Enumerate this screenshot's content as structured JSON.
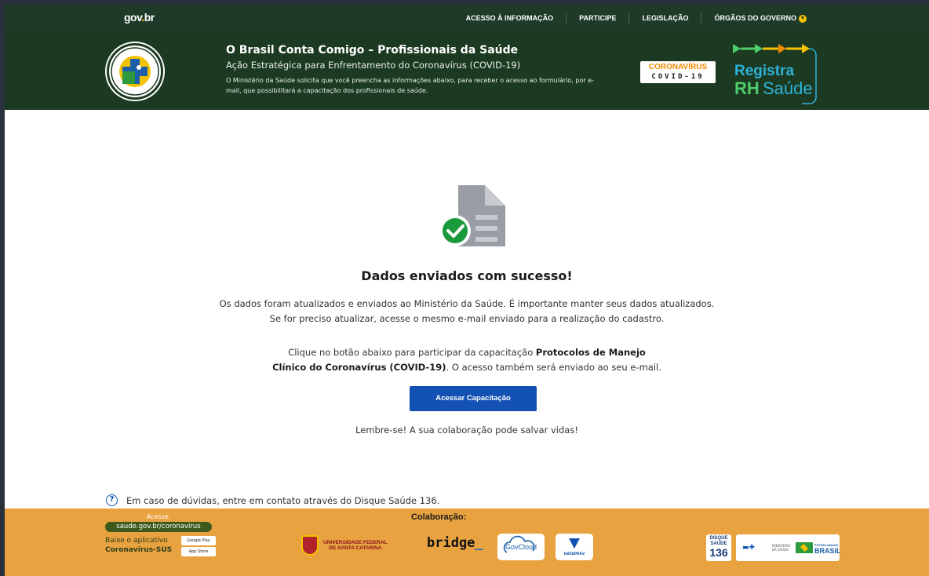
{
  "govbar": {
    "logo_main": "gov",
    "logo_dot": ".",
    "logo_suffix": "br",
    "links": [
      {
        "label": "ACESSO À INFORMAÇÃO"
      },
      {
        "label": "PARTICIPE"
      },
      {
        "label": "LEGISLAÇÃO"
      },
      {
        "label": "ÓRGÃOS DO GOVERNO"
      }
    ]
  },
  "header": {
    "title": "O Brasil Conta Comigo – Profissionais da Saúde",
    "subtitle": "Ação Estratégica para Enfrentamento do Coronavírus (COVID-19)",
    "description": "O Ministério da Saúde solicita que você preencha as informações abaixo, para receber o acesso ao formulário, por e-mail, que possibilitará a capacitação dos profissionais de saúde.",
    "seal_text_top": "CONTRA O CORONAVÍRUS",
    "seal_text_bottom": "O BRASIL CONTA COMIGO",
    "covid_badge_line1": "CORONAVÍRUS",
    "covid_badge_line2": "COVID-19",
    "rh_registra": "Registra",
    "rh_rh": "RH",
    "rh_saude": "Saúde"
  },
  "main": {
    "title": "Dados enviados com sucesso!",
    "line1": "Os dados foram atualizados e enviados ao Ministério da Saúde. É importante manter seus dados atualizados.",
    "line2": "Se for preciso atualizar, acesse o mesmo e-mail enviado para a realização do cadastro.",
    "cta_pre": "Clique no botão abaixo para participar da capacitação ",
    "cta_bold": "Protocolos de Manejo Clínico do Coronavírus (COVID-19)",
    "cta_post": ". O acesso também será enviado ao seu e-mail.",
    "button_label": "Acessar Capacitação",
    "reminder": "Lembre-se! A sua colaboração pode salvar vidas!"
  },
  "help": {
    "icon": "?",
    "text": "Em caso de dúvidas, entre em contato através do Disque Saúde 136."
  },
  "footer": {
    "acesse": "Acesse:",
    "url": "saude.gov.br/coronavirus",
    "baixe": "Baixe o aplicativo",
    "app_name": "Coronavírus-SUS",
    "google_play": "Google Play",
    "app_store": "App Store",
    "colaboracao": "Colaboração:",
    "ufsc_line1": "UNIVERSIDADE FEDERAL",
    "ufsc_line2": "DE SANTA CATARINA",
    "bridge": "bridge",
    "bridge_underscore": "_",
    "govcloud": "GovCloud",
    "dataprev": "DATAPREV",
    "disque_line1": "DISQUE",
    "disque_line2": "SAÚDE",
    "disque_number": "136",
    "ministerio": "MINISTÉRIO DA SAÚDE",
    "patria": "PÁTRIA AMADA",
    "brasil": "BRASIL"
  }
}
